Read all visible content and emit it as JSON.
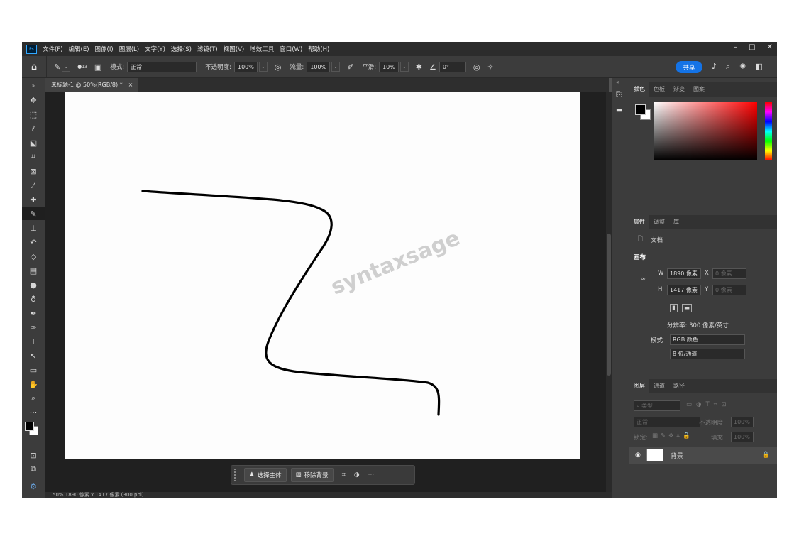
{
  "menubar": {
    "logo": "Ps",
    "items": [
      "文件(F)",
      "编辑(E)",
      "图像(I)",
      "图层(L)",
      "文字(Y)",
      "选择(S)",
      "滤镜(T)",
      "视图(V)",
      "增效工具",
      "窗口(W)",
      "帮助(H)"
    ]
  },
  "options": {
    "brush_size": "13",
    "mode_label": "模式:",
    "mode_value": "正常",
    "opacity_label": "不透明度:",
    "opacity_value": "100%",
    "flow_label": "流量:",
    "flow_value": "100%",
    "smoothing_label": "平滑:",
    "smoothing_value": "10%",
    "angle_value": "0°",
    "share_label": "共享"
  },
  "document": {
    "tab_title": "未标题-1 @ 50%(RGB/8) *",
    "tab_close": "×",
    "watermark": "syntaxsage",
    "status": "50%    1890 像素 x 1417 像素 (300 ppi)"
  },
  "context_bar": {
    "select_subject": "选择主体",
    "remove_background": "移除背景",
    "more": "···"
  },
  "color_panel": {
    "tabs": [
      "颜色",
      "色板",
      "渐变",
      "图案"
    ]
  },
  "properties_panel": {
    "tabs": [
      "属性",
      "调整",
      "库"
    ],
    "doc_label": "文档",
    "section": "画布",
    "w_label": "W",
    "w_value": "1890 像素",
    "h_label": "H",
    "h_value": "1417 像素",
    "x_label": "X",
    "x_value": "0 像素",
    "y_label": "Y",
    "y_value": "0 像素",
    "resolution": "分辨率: 300 像素/英寸",
    "mode_label": "模式",
    "mode_value": "RGB 颜色",
    "depth_value": "8 位/通道"
  },
  "layers_panel": {
    "tabs": [
      "图层",
      "通道",
      "路径"
    ],
    "search_placeholder": "类型",
    "blend_mode": "正常",
    "opacity_label": "不透明度:",
    "opacity_value": "100%",
    "lock_label": "锁定:",
    "fill_label": "填充:",
    "fill_value": "100%",
    "layer_name": "背景"
  },
  "colors": {
    "app_bg": "#535353",
    "panel_bg": "#3c3c3c",
    "accent": "#1473e6",
    "stroke": "#000000"
  }
}
